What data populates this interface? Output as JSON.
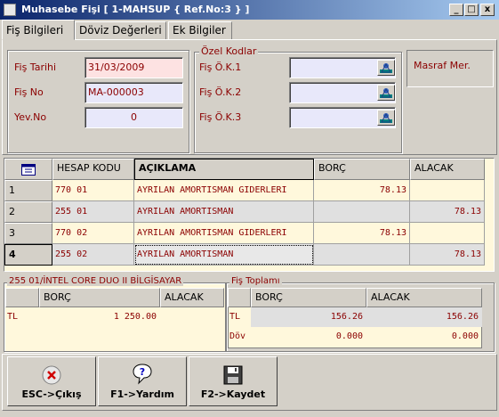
{
  "window": {
    "title": "Muhasebe Fişi [ 1-MAHSUP { Ref.No:3 } ]",
    "min_label": "_",
    "max_label": "□",
    "close_label": "x"
  },
  "tabs": [
    {
      "label": "Fiş Bilgileri"
    },
    {
      "label": "Döviz Değerleri"
    },
    {
      "label": "Ek Bilgiler"
    }
  ],
  "fis": {
    "tarih_label": "Fiş Tarihi",
    "tarih_value": "31/03/2009",
    "no_label": "Fiş No",
    "no_value": "MA-000003",
    "yevno_label": "Yev.No",
    "yevno_value": "0"
  },
  "ozel_kodlar": {
    "title": "Özel Kodlar",
    "ok1_label": "Fiş Ö.K.1",
    "ok2_label": "Fiş Ö.K.2",
    "ok3_label": "Fiş Ö.K.3"
  },
  "masraf": {
    "label": "Masraf Mer."
  },
  "grid": {
    "headers": {
      "hesap_kodu": "HESAP KODU",
      "aciklama": "AÇIKLAMA",
      "borc": "BORÇ",
      "alacak": "ALACAK"
    },
    "rows": [
      {
        "num": "1",
        "hesap": "770 01",
        "aciklama": "AYRILAN AMORTISMAN GIDERLERI",
        "borc": "78.13",
        "alacak": ""
      },
      {
        "num": "2",
        "hesap": "255 01",
        "aciklama": "AYRILAN AMORTISMAN",
        "borc": "",
        "alacak": "78.13"
      },
      {
        "num": "3",
        "hesap": "770 02",
        "aciklama": "AYRILAN AMORTISMAN GIDERLERI",
        "borc": "78.13",
        "alacak": ""
      },
      {
        "num": "4",
        "hesap": "255 02",
        "aciklama": "AYRILAN AMORTISMAN",
        "borc": "",
        "alacak": "78.13"
      }
    ]
  },
  "account_panel": {
    "title": "255 01/İNTEL CORE DUO II BİLGİSAYAR",
    "borc_header": "BORÇ",
    "alacak_header": "ALACAK",
    "row_currency": "TL",
    "row_borc": "1 250.00",
    "row_alacak": ""
  },
  "fis_toplami": {
    "title": "Fiş Toplamı",
    "borc_header": "BORÇ",
    "alacak_header": "ALACAK",
    "row1_currency": "TL",
    "row1_borc": "156.26",
    "row1_alacak": "156.26",
    "row2_currency": "Döv",
    "row2_borc": "0.000",
    "row2_alacak": "0.000"
  },
  "buttons": {
    "esc_label": "ESC->Çıkış",
    "f1_label": "F1->Yardım",
    "f2_label": "F2->Kaydet"
  },
  "colors": {
    "title_start": "#0a246a",
    "title_end": "#a6caf0",
    "value_text": "#8b0000",
    "grid_bg": "#fff8dc"
  }
}
